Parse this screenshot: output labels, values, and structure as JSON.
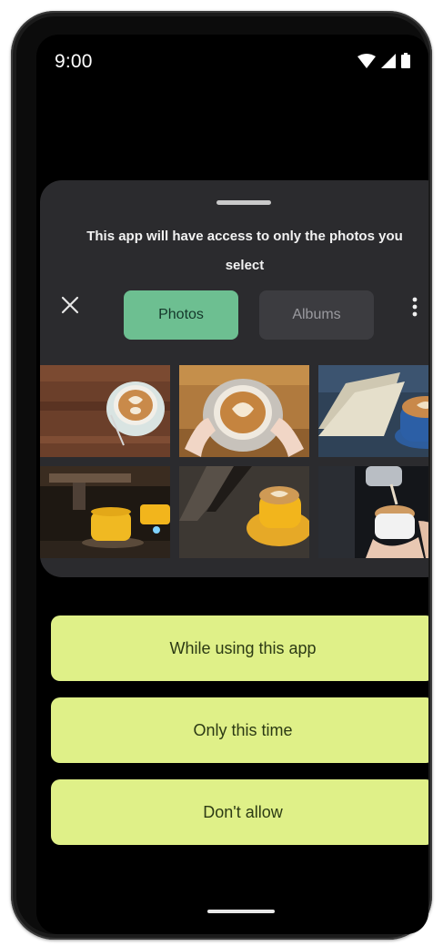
{
  "status_bar": {
    "time": "9:00",
    "icons": [
      "wifi-icon",
      "cellular-signal-icon",
      "battery-icon"
    ]
  },
  "sheet": {
    "title": "This app will have access to only the photos you select",
    "close_icon": "close-icon",
    "tabs": [
      {
        "label": "Photos",
        "selected": true
      },
      {
        "label": "Albums",
        "selected": false
      }
    ],
    "more_icon": "more-vertical-icon",
    "photos": [
      "latte-art-on-wooden-table",
      "hands-holding-latte",
      "latte-beside-open-book",
      "espresso-machine-with-yellow-cup",
      "latte-in-yellow-cup-on-dark-table",
      "barista-pouring-latte"
    ]
  },
  "permission_buttons": {
    "while_using": "While using this app",
    "only_this_time": "Only this time",
    "dont_allow": "Don't allow"
  },
  "colors": {
    "sheet_background": "#2b2b2e",
    "selected_tab": "#6dbf91",
    "unselected_tab": "#3c3c40",
    "permission_button": "#dff088",
    "screen_background": "#000000"
  }
}
